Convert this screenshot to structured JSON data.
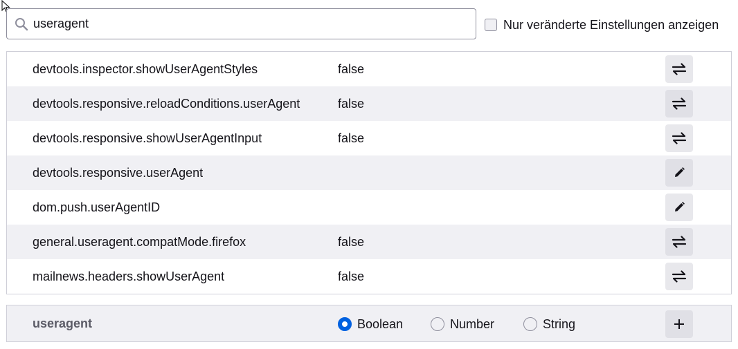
{
  "search": {
    "value": "useragent"
  },
  "modified_only": {
    "label": "Nur veränderte Einstellungen anzeigen",
    "checked": false
  },
  "prefs": [
    {
      "name": "devtools.inspector.showUserAgentStyles",
      "value": "false",
      "action": "toggle-icon"
    },
    {
      "name": "devtools.responsive.reloadConditions.userAgent",
      "value": "false",
      "action": "toggle-icon"
    },
    {
      "name": "devtools.responsive.showUserAgentInput",
      "value": "false",
      "action": "toggle-icon"
    },
    {
      "name": "devtools.responsive.userAgent",
      "value": "",
      "action": "edit-icon"
    },
    {
      "name": "dom.push.userAgentID",
      "value": "",
      "action": "edit-icon"
    },
    {
      "name": "general.useragent.compatMode.firefox",
      "value": "false",
      "action": "toggle-icon"
    },
    {
      "name": "mailnews.headers.showUserAgent",
      "value": "false",
      "action": "toggle-icon"
    }
  ],
  "new_pref": {
    "name": "useragent",
    "types": [
      {
        "label": "Boolean",
        "checked": true
      },
      {
        "label": "Number",
        "checked": false
      },
      {
        "label": "String",
        "checked": false
      }
    ],
    "add_icon": "plus-icon"
  },
  "colors": {
    "accent": "#0061e0",
    "row_alt": "#f0f0f4",
    "border": "#cfcfd8"
  }
}
